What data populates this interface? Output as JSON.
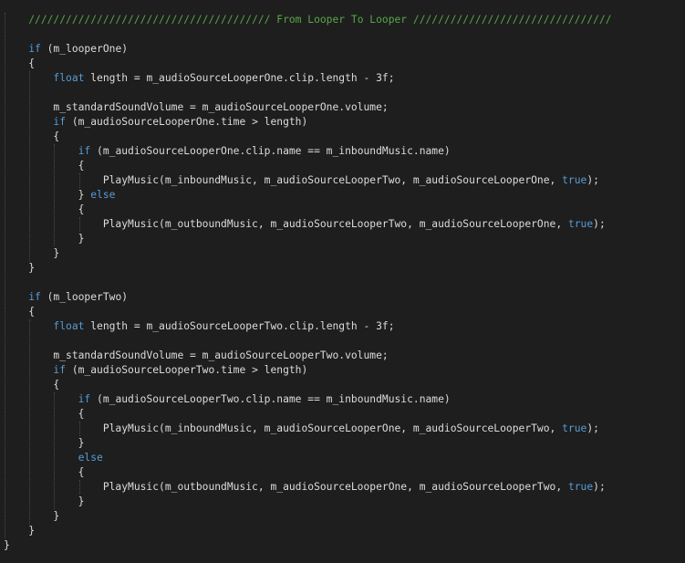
{
  "editor": {
    "colors": {
      "background": "#1e1e1e",
      "text": "#dcdcdc",
      "keyword": "#569cd6",
      "comment": "#57a64a",
      "indent_guide": "#4a4a4a"
    },
    "lines": [
      {
        "indent": "    ",
        "tokens": [
          {
            "t": "cm",
            "v": "/////////////////////////////////////// From Looper To Looper ////////////////////////////////"
          }
        ]
      },
      {
        "indent": "",
        "tokens": []
      },
      {
        "indent": "    ",
        "tokens": [
          {
            "t": "kw",
            "v": "if"
          },
          {
            "t": "plain",
            "v": " (m_looperOne)"
          }
        ]
      },
      {
        "indent": "    ",
        "tokens": [
          {
            "t": "plain",
            "v": "{"
          }
        ]
      },
      {
        "indent": "        ",
        "tokens": [
          {
            "t": "kw",
            "v": "float"
          },
          {
            "t": "plain",
            "v": " length = m_audioSourceLooperOne.clip.length - 3f;"
          }
        ]
      },
      {
        "indent": "",
        "tokens": []
      },
      {
        "indent": "        ",
        "tokens": [
          {
            "t": "plain",
            "v": "m_standardSoundVolume = m_audioSourceLooperOne.volume;"
          }
        ]
      },
      {
        "indent": "        ",
        "tokens": [
          {
            "t": "kw",
            "v": "if"
          },
          {
            "t": "plain",
            "v": " (m_audioSourceLooperOne.time > length)"
          }
        ]
      },
      {
        "indent": "        ",
        "tokens": [
          {
            "t": "plain",
            "v": "{"
          }
        ]
      },
      {
        "indent": "            ",
        "tokens": [
          {
            "t": "kw",
            "v": "if"
          },
          {
            "t": "plain",
            "v": " (m_audioSourceLooperOne.clip.name == m_inboundMusic.name)"
          }
        ]
      },
      {
        "indent": "            ",
        "tokens": [
          {
            "t": "plain",
            "v": "{"
          }
        ]
      },
      {
        "indent": "                ",
        "tokens": [
          {
            "t": "plain",
            "v": "PlayMusic(m_inboundMusic, m_audioSourceLooperTwo, m_audioSourceLooperOne, "
          },
          {
            "t": "kw",
            "v": "true"
          },
          {
            "t": "plain",
            "v": ");"
          }
        ]
      },
      {
        "indent": "            ",
        "tokens": [
          {
            "t": "plain",
            "v": "} "
          },
          {
            "t": "kw",
            "v": "else"
          }
        ]
      },
      {
        "indent": "            ",
        "tokens": [
          {
            "t": "plain",
            "v": "{"
          }
        ]
      },
      {
        "indent": "                ",
        "tokens": [
          {
            "t": "plain",
            "v": "PlayMusic(m_outboundMusic, m_audioSourceLooperTwo, m_audioSourceLooperOne, "
          },
          {
            "t": "kw",
            "v": "true"
          },
          {
            "t": "plain",
            "v": ");"
          }
        ]
      },
      {
        "indent": "            ",
        "tokens": [
          {
            "t": "plain",
            "v": "}"
          }
        ]
      },
      {
        "indent": "        ",
        "tokens": [
          {
            "t": "plain",
            "v": "}"
          }
        ]
      },
      {
        "indent": "    ",
        "tokens": [
          {
            "t": "plain",
            "v": "}"
          }
        ]
      },
      {
        "indent": "",
        "tokens": []
      },
      {
        "indent": "    ",
        "tokens": [
          {
            "t": "kw",
            "v": "if"
          },
          {
            "t": "plain",
            "v": " (m_looperTwo)"
          }
        ]
      },
      {
        "indent": "    ",
        "tokens": [
          {
            "t": "plain",
            "v": "{"
          }
        ]
      },
      {
        "indent": "        ",
        "tokens": [
          {
            "t": "kw",
            "v": "float"
          },
          {
            "t": "plain",
            "v": " length = m_audioSourceLooperTwo.clip.length - 3f;"
          }
        ]
      },
      {
        "indent": "",
        "tokens": []
      },
      {
        "indent": "        ",
        "tokens": [
          {
            "t": "plain",
            "v": "m_standardSoundVolume = m_audioSourceLooperTwo.volume;"
          }
        ]
      },
      {
        "indent": "        ",
        "tokens": [
          {
            "t": "kw",
            "v": "if"
          },
          {
            "t": "plain",
            "v": " (m_audioSourceLooperTwo.time > length)"
          }
        ]
      },
      {
        "indent": "        ",
        "tokens": [
          {
            "t": "plain",
            "v": "{"
          }
        ]
      },
      {
        "indent": "            ",
        "tokens": [
          {
            "t": "kw",
            "v": "if"
          },
          {
            "t": "plain",
            "v": " (m_audioSourceLooperTwo.clip.name == m_inboundMusic.name)"
          }
        ]
      },
      {
        "indent": "            ",
        "tokens": [
          {
            "t": "plain",
            "v": "{"
          }
        ]
      },
      {
        "indent": "                ",
        "tokens": [
          {
            "t": "plain",
            "v": "PlayMusic(m_inboundMusic, m_audioSourceLooperOne, m_audioSourceLooperTwo, "
          },
          {
            "t": "kw",
            "v": "true"
          },
          {
            "t": "plain",
            "v": ");"
          }
        ]
      },
      {
        "indent": "            ",
        "tokens": [
          {
            "t": "plain",
            "v": "}"
          }
        ]
      },
      {
        "indent": "            ",
        "tokens": [
          {
            "t": "kw",
            "v": "else"
          }
        ]
      },
      {
        "indent": "            ",
        "tokens": [
          {
            "t": "plain",
            "v": "{"
          }
        ]
      },
      {
        "indent": "                ",
        "tokens": [
          {
            "t": "plain",
            "v": "PlayMusic(m_outboundMusic, m_audioSourceLooperOne, m_audioSourceLooperTwo, "
          },
          {
            "t": "kw",
            "v": "true"
          },
          {
            "t": "plain",
            "v": ");"
          }
        ]
      },
      {
        "indent": "            ",
        "tokens": [
          {
            "t": "plain",
            "v": "}"
          }
        ]
      },
      {
        "indent": "        ",
        "tokens": [
          {
            "t": "plain",
            "v": "}"
          }
        ]
      },
      {
        "indent": "    ",
        "tokens": [
          {
            "t": "plain",
            "v": "}"
          }
        ]
      },
      {
        "indent": "",
        "tokens": [
          {
            "t": "plain",
            "v": "}"
          }
        ]
      }
    ]
  }
}
